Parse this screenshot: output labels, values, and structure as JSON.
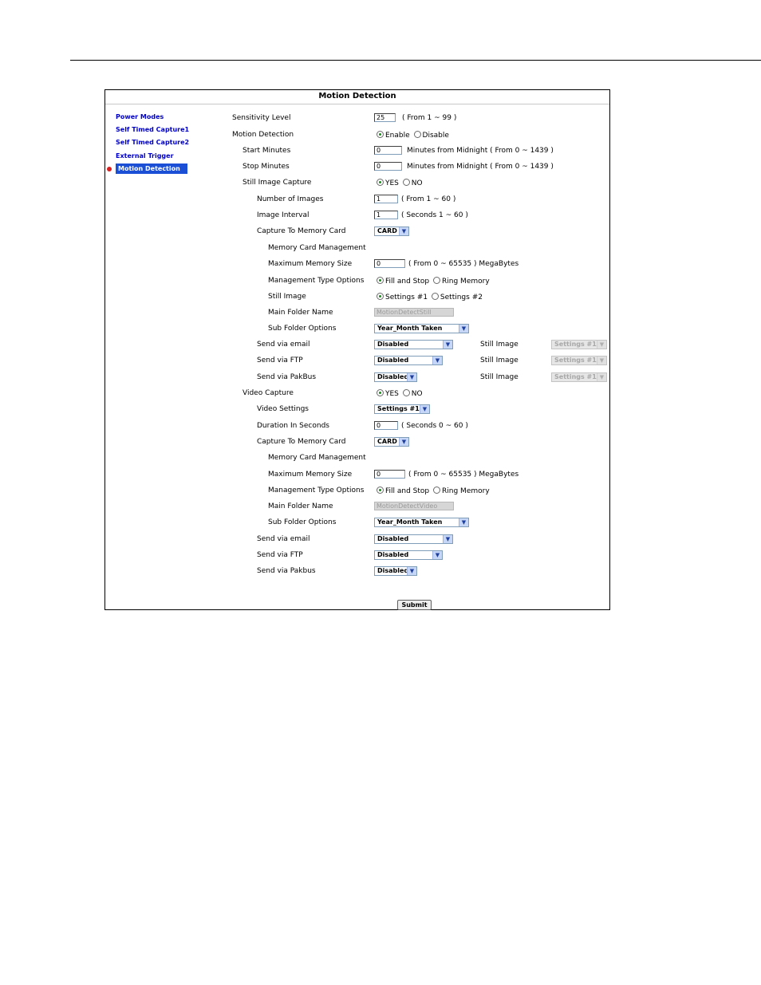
{
  "panel": {
    "title": "Motion Detection"
  },
  "nav": {
    "items": [
      {
        "label": "Power Modes"
      },
      {
        "label": "Self Timed Capture1"
      },
      {
        "label": "Self Timed Capture2"
      },
      {
        "label": "External Trigger"
      },
      {
        "label": "Motion Detection",
        "active": true
      }
    ]
  },
  "form": {
    "sensitivity": {
      "label": "Sensitivity Level",
      "value": "25",
      "hint": "( From 1 ~ 99 )"
    },
    "motion_detection": {
      "label": "Motion Detection",
      "options": [
        "Enable",
        "Disable"
      ],
      "selected": "Enable"
    },
    "start_minutes": {
      "label": "Start Minutes",
      "value": "0",
      "hint": "Minutes from Midnight ( From 0 ~ 1439 )"
    },
    "stop_minutes": {
      "label": "Stop Minutes",
      "value": "0",
      "hint": "Minutes from Midnight ( From 0 ~ 1439 )"
    },
    "still": {
      "label": "Still Image Capture",
      "options": [
        "YES",
        "NO"
      ],
      "selected": "YES",
      "num_images": {
        "label": "Number of Images",
        "value": "1",
        "hint": "( From 1 ~ 60 )"
      },
      "interval": {
        "label": "Image Interval",
        "value": "1",
        "hint": "( Seconds 1 ~ 60 )"
      },
      "capture_to_card": {
        "label": "Capture To Memory Card",
        "value": "CARD"
      },
      "mem_mgmt": {
        "label": "Memory Card Management"
      },
      "max_mem": {
        "label": "Maximum Memory Size",
        "value": "0",
        "hint": "( From 0 ~ 65535 ) MegaBytes"
      },
      "mgmt_type": {
        "label": "Management Type Options",
        "options": [
          "Fill and Stop",
          "Ring Memory"
        ],
        "selected": "Fill and Stop"
      },
      "still_image": {
        "label": "Still Image",
        "options": [
          "Settings #1",
          "Settings #2"
        ],
        "selected": "Settings #1"
      },
      "main_folder": {
        "label": "Main Folder Name",
        "value": "MotionDetectStill"
      },
      "sub_folder": {
        "label": "Sub Folder Options",
        "value": "Year_Month Taken"
      },
      "send_email": {
        "label": "Send via email",
        "value": "Disabled",
        "side_label": "Still Image",
        "side_value": "Settings #1"
      },
      "send_ftp": {
        "label": "Send via FTP",
        "value": "Disabled",
        "side_label": "Still Image",
        "side_value": "Settings #1"
      },
      "send_pakbus": {
        "label": "Send via PakBus",
        "value": "Disabled",
        "side_label": "Still Image",
        "side_value": "Settings #1"
      }
    },
    "video": {
      "label": "Video Capture",
      "options": [
        "YES",
        "NO"
      ],
      "selected": "YES",
      "settings": {
        "label": "Video Settings",
        "value": "Settings #1"
      },
      "duration": {
        "label": "Duration In Seconds",
        "value": "0",
        "hint": "( Seconds 0 ~ 60 )"
      },
      "capture_to_card": {
        "label": "Capture To Memory Card",
        "value": "CARD"
      },
      "mem_mgmt": {
        "label": "Memory Card Management"
      },
      "max_mem": {
        "label": "Maximum Memory Size",
        "value": "0",
        "hint": "( From 0 ~ 65535 ) MegaBytes"
      },
      "mgmt_type": {
        "label": "Management Type Options",
        "options": [
          "Fill and Stop",
          "Ring Memory"
        ],
        "selected": "Fill and Stop"
      },
      "main_folder": {
        "label": "Main Folder Name",
        "value": "MotionDetectVideo"
      },
      "sub_folder": {
        "label": "Sub Folder Options",
        "value": "Year_Month Taken"
      },
      "send_email": {
        "label": "Send via email",
        "value": "Disabled"
      },
      "send_ftp": {
        "label": "Send via FTP",
        "value": "Disabled"
      },
      "send_pakbus": {
        "label": "Send via Pakbus",
        "value": "Disabled"
      }
    },
    "submit_label": "Submit"
  }
}
